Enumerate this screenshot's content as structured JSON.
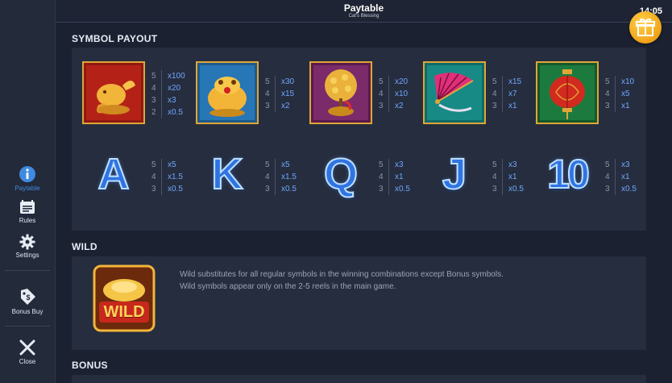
{
  "header": {
    "title": "Paytable",
    "subtitle": "Cat's Blessing",
    "clock": "14:05"
  },
  "sidebar": {
    "items": [
      {
        "label": "Paytable",
        "icon": "info-icon"
      },
      {
        "label": "Rules",
        "icon": "rules-icon"
      },
      {
        "label": "Settings",
        "icon": "gear-icon"
      },
      {
        "label": "Bonus Buy",
        "icon": "bonus-buy-icon"
      },
      {
        "label": "Close",
        "icon": "close-icon"
      }
    ]
  },
  "sections": {
    "symbol_payout": "SYMBOL PAYOUT",
    "wild": "WILD",
    "bonus": "BONUS"
  },
  "symbols_row1": [
    {
      "name": "golden-koi",
      "pays": [
        [
          "5",
          "x100"
        ],
        [
          "4",
          "x20"
        ],
        [
          "3",
          "x3"
        ],
        [
          "2",
          "x0.5"
        ]
      ]
    },
    {
      "name": "golden-toad",
      "pays": [
        [
          "5",
          "x30"
        ],
        [
          "4",
          "x15"
        ],
        [
          "3",
          "x2"
        ]
      ]
    },
    {
      "name": "money-tree",
      "pays": [
        [
          "5",
          "x20"
        ],
        [
          "4",
          "x10"
        ],
        [
          "3",
          "x2"
        ]
      ]
    },
    {
      "name": "fan",
      "pays": [
        [
          "5",
          "x15"
        ],
        [
          "4",
          "x7"
        ],
        [
          "3",
          "x1"
        ]
      ]
    },
    {
      "name": "lantern",
      "pays": [
        [
          "5",
          "x10"
        ],
        [
          "4",
          "x5"
        ],
        [
          "3",
          "x1"
        ]
      ]
    }
  ],
  "symbols_row2": [
    {
      "letter": "A",
      "pays": [
        [
          "5",
          "x5"
        ],
        [
          "4",
          "x1.5"
        ],
        [
          "3",
          "x0.5"
        ]
      ]
    },
    {
      "letter": "K",
      "pays": [
        [
          "5",
          "x5"
        ],
        [
          "4",
          "x1.5"
        ],
        [
          "3",
          "x0.5"
        ]
      ]
    },
    {
      "letter": "Q",
      "pays": [
        [
          "5",
          "x3"
        ],
        [
          "4",
          "x1"
        ],
        [
          "3",
          "x0.5"
        ]
      ]
    },
    {
      "letter": "J",
      "pays": [
        [
          "5",
          "x3"
        ],
        [
          "4",
          "x1"
        ],
        [
          "3",
          "x0.5"
        ]
      ]
    },
    {
      "letter": "10",
      "pays": [
        [
          "5",
          "x3"
        ],
        [
          "4",
          "x1"
        ],
        [
          "3",
          "x0.5"
        ]
      ]
    }
  ],
  "wild": {
    "badge": "WILD",
    "line1": "Wild substitutes for all regular symbols in the winning combinations except Bonus symbols.",
    "line2": "Wild symbols appear only on the 2-5 reels in the main game."
  },
  "colors": {
    "accent": "#3f8ae0",
    "payout": "#6ea7ff",
    "panel": "#262d3e",
    "gift": "#f0a21a"
  }
}
